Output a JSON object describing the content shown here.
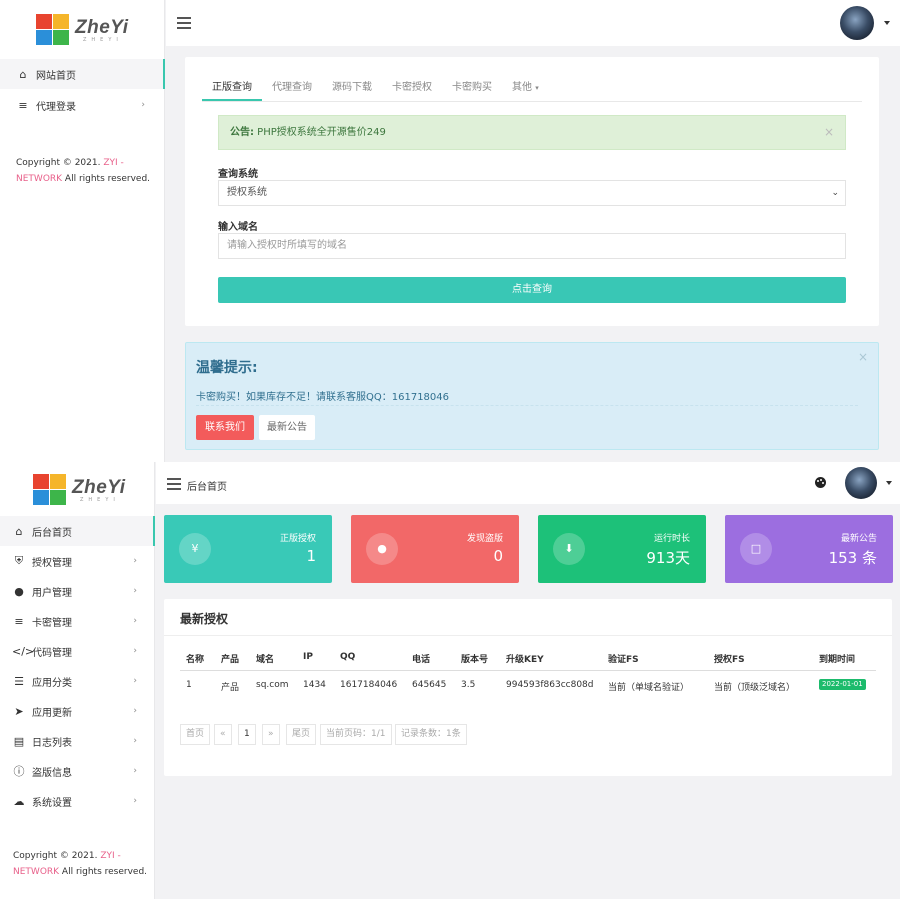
{
  "top": {
    "logo": {
      "name": "ZheYi",
      "tagline": "ZHEYI"
    },
    "sidebar": {
      "items": [
        {
          "label": "网站首页",
          "icon": "home-icon"
        },
        {
          "label": "代理登录",
          "icon": "list-icon"
        }
      ]
    },
    "copyright": {
      "prefix": "Copyright © 2021. ",
      "brand1": "ZYI -",
      "brand2": "NETWORK",
      "suffix": " All rights reserved."
    },
    "tabs": [
      "正版查询",
      "代理查询",
      "源码下载",
      "卡密授权",
      "卡密购买",
      "其他"
    ],
    "notice": {
      "label": "公告:",
      "text": " PHP授权系统全开源售价249"
    },
    "form": {
      "system_label": "查询系统",
      "system_value": "授权系统",
      "domain_label": "输入域名",
      "domain_placeholder": "请输入授权时所填写的域名",
      "submit": "点击查询"
    },
    "tip": {
      "title": "温馨提示:",
      "message": "卡密购买！如果库存不足！请联系客服QQ：161718046",
      "contact_button": "联系我们",
      "news_button": "最新公告"
    },
    "colors": {
      "accent": "#39c7b5",
      "notice_bg": "#dff0d8",
      "tip_bg": "#d9edf7",
      "danger": "#f35b5b"
    }
  },
  "bottom": {
    "logo": {
      "name": "ZheYi",
      "tagline": "ZHEYI"
    },
    "page_title": "后台首页",
    "sidebar": {
      "items": [
        {
          "label": "后台首页",
          "icon": "home-icon"
        },
        {
          "label": "授权管理",
          "icon": "shield-icon"
        },
        {
          "label": "用户管理",
          "icon": "user-icon"
        },
        {
          "label": "卡密管理",
          "icon": "menu-icon"
        },
        {
          "label": "代码管理",
          "icon": "code-icon"
        },
        {
          "label": "应用分类",
          "icon": "list-check-icon"
        },
        {
          "label": "应用更新",
          "icon": "rocket-icon"
        },
        {
          "label": "日志列表",
          "icon": "comment-icon"
        },
        {
          "label": "盗版信息",
          "icon": "info-icon"
        },
        {
          "label": "系统设置",
          "icon": "cloud-icon"
        }
      ]
    },
    "copyright": {
      "prefix": "Copyright © 2021. ",
      "brand1": "ZYI -",
      "brand2": "NETWORK",
      "suffix": " All rights reserved."
    },
    "stats": [
      {
        "label": "正版授权",
        "value": "1",
        "icon": "yen-icon",
        "color": "#39c9b7"
      },
      {
        "label": "发现盗版",
        "value": "0",
        "icon": "user-icon",
        "color": "#f26868"
      },
      {
        "label": "运行时长",
        "value": "913天",
        "icon": "download-icon",
        "color": "#1dc179"
      },
      {
        "label": "最新公告",
        "value": "153 条",
        "icon": "message-icon",
        "color": "#9c6ee0"
      }
    ],
    "table": {
      "title": "最新授权",
      "headers": [
        "名称",
        "产品",
        "域名",
        "IP",
        "QQ",
        "电话",
        "版本号",
        "升级KEY",
        "验证FS",
        "授权FS",
        "到期时间"
      ],
      "row": [
        "1",
        "产品",
        "sq.com",
        "1434",
        "1617184046",
        "645645",
        "3.5",
        "994593f863cc808d",
        "当前（单域名验证）",
        "当前（顶级泛域名）",
        "2022-01-01"
      ]
    },
    "pagination": [
      "首页",
      "«",
      "1",
      "»",
      "尾页",
      "当前页码：1/1",
      "记录条数：1条"
    ]
  }
}
